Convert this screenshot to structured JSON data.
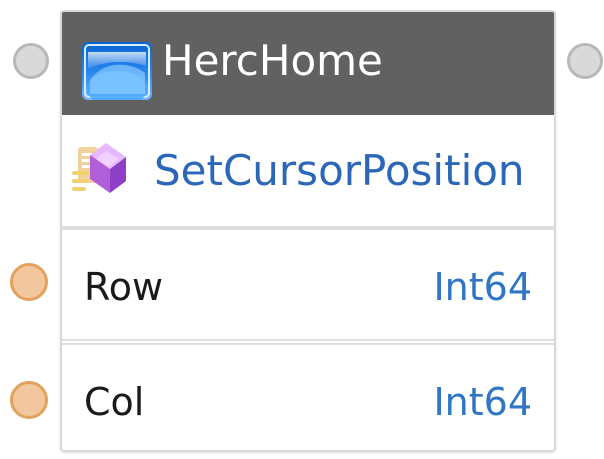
{
  "header": {
    "title": "HercHome",
    "icon": "app-window-icon"
  },
  "action": {
    "label": "SetCursorPosition",
    "icon": "action-icon"
  },
  "parameters": [
    {
      "name": "Row",
      "type": "Int64"
    },
    {
      "name": "Col",
      "type": "Int64"
    }
  ],
  "colors": {
    "header_bg": "#616161",
    "action_text": "#2a67b8",
    "param_type_text": "#2f76c6",
    "port_neutral": "#d9d9d9",
    "port_param": "#f3c79e"
  }
}
